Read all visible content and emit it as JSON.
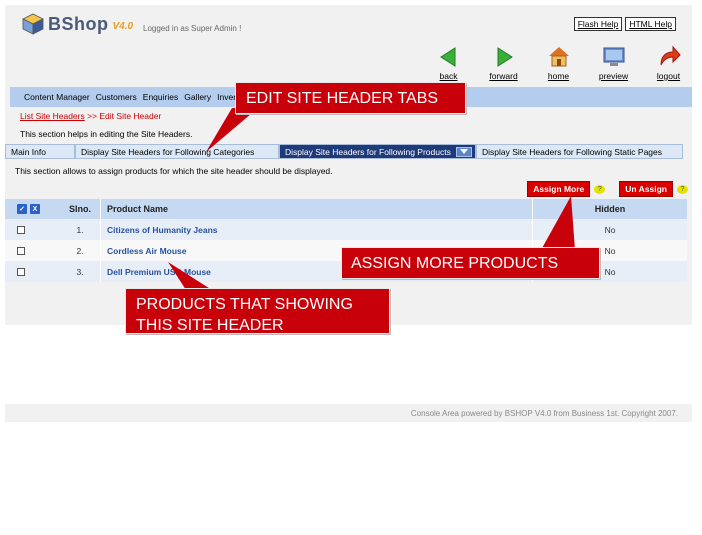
{
  "header": {
    "app_name": "BShop",
    "version": "V4.0",
    "logged_in": "Logged in as Super Admin !",
    "help_links": [
      "Flash Help",
      "HTML Help"
    ]
  },
  "toolbar": [
    {
      "label": "back",
      "icon": "arrow-left-icon"
    },
    {
      "label": "forward",
      "icon": "arrow-right-icon"
    },
    {
      "label": "home",
      "icon": "house-icon"
    },
    {
      "label": "preview",
      "icon": "monitor-icon"
    },
    {
      "label": "logout",
      "icon": "logout-arrow-icon"
    }
  ],
  "nav": [
    "Content Manager",
    "Customers",
    "Enquiries",
    "Gallery",
    "Invento"
  ],
  "breadcrumb": {
    "link": "List Site Headers",
    "separator": " >> ",
    "current": "Edit Site Header"
  },
  "help_text": "This section helps in editing the Site Headers.",
  "tabs": [
    {
      "label": "Main Info",
      "active": false
    },
    {
      "label": "Display Site Headers for Following Categories",
      "active": false
    },
    {
      "label": "Display Site Headers for Following Products",
      "active": true
    },
    {
      "label": "Display Site Headers for Following Static Pages",
      "active": false
    }
  ],
  "section_info": "This section allows to assign products for which the site header should be displayed.",
  "actions": {
    "assign": "Assign More",
    "unassign": "Un Assign",
    "help_glyph": "?"
  },
  "table": {
    "head_boxes": [
      "✓",
      "X"
    ],
    "columns": [
      "Slno.",
      "Product Name",
      "Hidden"
    ],
    "rows": [
      {
        "slno": "1.",
        "name": "Citizens of Humanity Jeans",
        "hidden": "No"
      },
      {
        "slno": "2.",
        "name": "Cordless Air Mouse",
        "hidden": "No"
      },
      {
        "slno": "3.",
        "name": "Dell Premium USB Mouse",
        "hidden": "No"
      }
    ]
  },
  "footer": "Console Area powered by BSHOP V4.0 from Business 1st. Copyright 2007.",
  "callouts": {
    "tabs": "EDIT SITE HEADER TABS",
    "assign": "ASSIGN MORE PRODUCTS",
    "products": "PRODUCTS THAT SHOWING THIS SITE HEADER"
  },
  "colors": {
    "callout": "#c8000a",
    "nav": "#b4cdef",
    "active_tab": "#1e3a7a",
    "table_head": "#c6d9f3"
  }
}
